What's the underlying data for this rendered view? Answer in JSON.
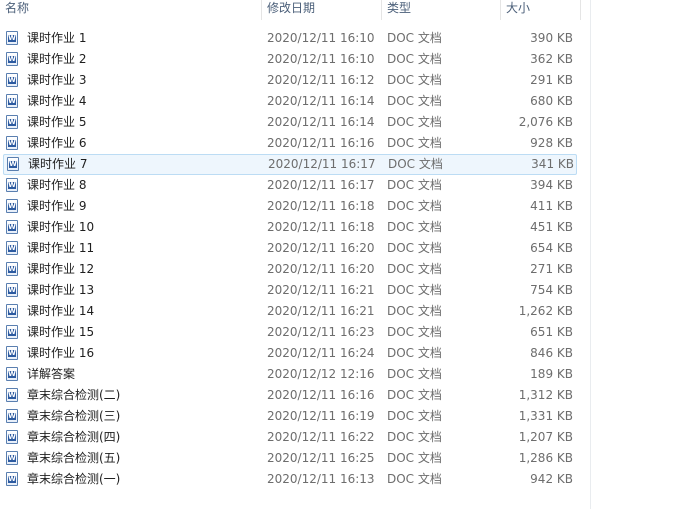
{
  "columns": {
    "name": "名称",
    "date": "修改日期",
    "type": "类型",
    "size": "大小"
  },
  "files": [
    {
      "name": "课时作业 1",
      "date": "2020/12/11 16:10",
      "type": "DOC 文档",
      "size": "390 KB",
      "icon": "word-doc-icon"
    },
    {
      "name": "课时作业 2",
      "date": "2020/12/11 16:10",
      "type": "DOC 文档",
      "size": "362 KB",
      "icon": "word-doc-icon"
    },
    {
      "name": "课时作业 3",
      "date": "2020/12/11 16:12",
      "type": "DOC 文档",
      "size": "291 KB",
      "icon": "word-doc-icon"
    },
    {
      "name": "课时作业 4",
      "date": "2020/12/11 16:14",
      "type": "DOC 文档",
      "size": "680 KB",
      "icon": "word-doc-icon"
    },
    {
      "name": "课时作业 5",
      "date": "2020/12/11 16:14",
      "type": "DOC 文档",
      "size": "2,076 KB",
      "icon": "word-doc-icon"
    },
    {
      "name": "课时作业 6",
      "date": "2020/12/11 16:16",
      "type": "DOC 文档",
      "size": "928 KB",
      "icon": "word-doc-icon"
    },
    {
      "name": "课时作业 7",
      "date": "2020/12/11 16:17",
      "type": "DOC 文档",
      "size": "341 KB",
      "icon": "word-doc-icon",
      "selected": true
    },
    {
      "name": "课时作业 8",
      "date": "2020/12/11 16:17",
      "type": "DOC 文档",
      "size": "394 KB",
      "icon": "word-doc-icon"
    },
    {
      "name": "课时作业 9",
      "date": "2020/12/11 16:18",
      "type": "DOC 文档",
      "size": "411 KB",
      "icon": "word-doc-icon"
    },
    {
      "name": "课时作业 10",
      "date": "2020/12/11 16:18",
      "type": "DOC 文档",
      "size": "451 KB",
      "icon": "word-doc-icon"
    },
    {
      "name": "课时作业 11",
      "date": "2020/12/11 16:20",
      "type": "DOC 文档",
      "size": "654 KB",
      "icon": "word-doc-icon"
    },
    {
      "name": "课时作业 12",
      "date": "2020/12/11 16:20",
      "type": "DOC 文档",
      "size": "271 KB",
      "icon": "word-doc-icon"
    },
    {
      "name": "课时作业 13",
      "date": "2020/12/11 16:21",
      "type": "DOC 文档",
      "size": "754 KB",
      "icon": "word-doc-icon"
    },
    {
      "name": "课时作业 14",
      "date": "2020/12/11 16:21",
      "type": "DOC 文档",
      "size": "1,262 KB",
      "icon": "word-doc-icon"
    },
    {
      "name": "课时作业 15",
      "date": "2020/12/11 16:23",
      "type": "DOC 文档",
      "size": "651 KB",
      "icon": "word-doc-icon"
    },
    {
      "name": "课时作业 16",
      "date": "2020/12/11 16:24",
      "type": "DOC 文档",
      "size": "846 KB",
      "icon": "word-doc-icon"
    },
    {
      "name": "详解答案",
      "date": "2020/12/12 12:16",
      "type": "DOC 文档",
      "size": "189 KB",
      "icon": "word-doc-icon"
    },
    {
      "name": "章末综合检测(二)",
      "date": "2020/12/11 16:16",
      "type": "DOC 文档",
      "size": "1,312 KB",
      "icon": "word-doc-icon"
    },
    {
      "name": "章末综合检测(三)",
      "date": "2020/12/11 16:19",
      "type": "DOC 文档",
      "size": "1,331 KB",
      "icon": "word-doc-icon"
    },
    {
      "name": "章末综合检测(四)",
      "date": "2020/12/11 16:22",
      "type": "DOC 文档",
      "size": "1,207 KB",
      "icon": "word-doc-icon"
    },
    {
      "name": "章末综合检测(五)",
      "date": "2020/12/11 16:25",
      "type": "DOC 文档",
      "size": "1,286 KB",
      "icon": "word-doc-icon"
    },
    {
      "name": "章末综合检测(一)",
      "date": "2020/12/11 16:13",
      "type": "DOC 文档",
      "size": "942 KB",
      "icon": "word-doc-icon"
    }
  ],
  "colors": {
    "header_text": "#4c607a",
    "selection_bg": "#eef6fd",
    "selection_border": "#bcdcf4",
    "meta_text": "#6d6d6d"
  }
}
